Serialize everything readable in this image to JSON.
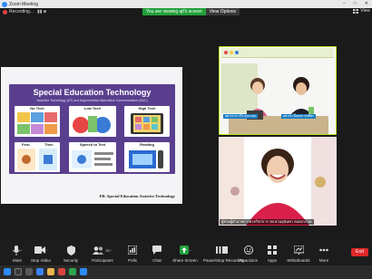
{
  "window": {
    "title": "Zoom Meeting",
    "controls": [
      "–",
      "□",
      "✕"
    ]
  },
  "top": {
    "recording_label": "Recording...",
    "viewing_text": "You are viewing ajf's screen",
    "view_options": "View Options",
    "view_label": "View"
  },
  "slide": {
    "title": "Special Education Technology",
    "subtitle": "Assistive Technology (AT) and Augmentative Alternative Communication (AAC)",
    "cards": [
      {
        "label": "No Tech"
      },
      {
        "label": "Low Tech"
      },
      {
        "label": "High Tech"
      },
      {
        "label": "First"
      },
      {
        "label": "Then"
      },
      {
        "label": "Speech to Text"
      },
      {
        "label": "Reading"
      }
    ],
    "footer": "FB: Special Education Assistive Technology"
  },
  "participants": [
    {
      "name": "ผศ.ดร.ดาวใจ ดุจนาผล"
    },
    {
      "name": "ผู้ช่วยผู้อำนวยการฝ่ายวิชาการ รพ.สวนสุนันทา ลลลลาภวด"
    }
  ],
  "toolbar": {
    "items": [
      {
        "label": "Mute",
        "icon": "microphone-icon",
        "caret": true
      },
      {
        "label": "Stop Video",
        "icon": "video-camera-icon",
        "caret": true
      },
      {
        "label": "Security",
        "icon": "shield-icon",
        "caret": false
      },
      {
        "label": "Participants",
        "icon": "participants-icon",
        "caret": true,
        "count": "33"
      },
      {
        "label": "Polls",
        "icon": "polls-icon",
        "caret": false
      },
      {
        "label": "Chat",
        "icon": "chat-icon",
        "caret": false
      },
      {
        "label": "Share Screen",
        "icon": "share-screen-icon",
        "caret": true
      },
      {
        "label": "Pause/Stop Recording",
        "icon": "recording-icon",
        "caret": false
      },
      {
        "label": "Reactions",
        "icon": "reactions-icon",
        "caret": false
      },
      {
        "label": "Apps",
        "icon": "apps-icon",
        "caret": false
      },
      {
        "label": "Whiteboards",
        "icon": "whiteboard-icon",
        "caret": false
      },
      {
        "label": "More",
        "icon": "more-icon",
        "caret": false
      }
    ],
    "end_label": "End"
  },
  "clock": {
    "time": "10:11 AM",
    "date": "5/25/2023"
  },
  "colors": {
    "accent": "#2d8cff",
    "viewing_bar": "#22a03a",
    "end": "#e02828",
    "slide_bg": "#5a3f8f",
    "active_speaker": "#b5e61d"
  }
}
